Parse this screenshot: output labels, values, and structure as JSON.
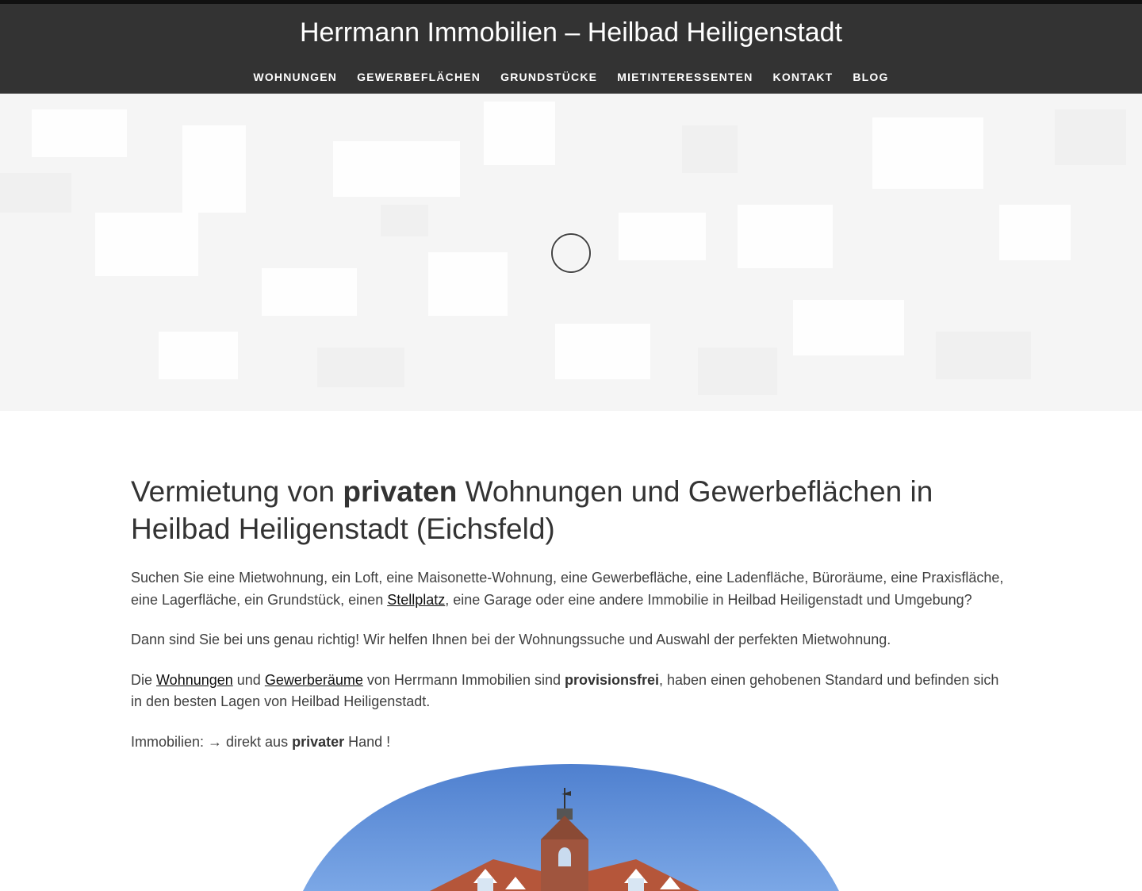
{
  "site": {
    "title": "Herrmann Immobilien – Heilbad Heiligenstadt"
  },
  "nav": {
    "items": [
      {
        "label": "WOHNUNGEN"
      },
      {
        "label": "GEWERBEFLÄCHEN"
      },
      {
        "label": "GRUNDSTÜCKE"
      },
      {
        "label": "MIETINTERESSENTEN"
      },
      {
        "label": "KONTAKT"
      },
      {
        "label": "BLOG"
      }
    ]
  },
  "hero": {
    "loader_icon": "loading-spinner-icon"
  },
  "main": {
    "headline": {
      "part1": "Vermietung von ",
      "bold": "privaten",
      "part2": " Wohnungen und Gewerbeflächen in Heilbad Heiligenstadt (Eichsfeld)"
    },
    "p1": {
      "text1": "Suchen Sie eine Mietwohnung, ein Loft, eine Maisonette-Wohnung, eine Gewerbefläche, eine Ladenfläche, Büroräume, eine Praxisfläche, eine Lagerfläche, ein Grundstück, einen ",
      "link": "Stellplatz",
      "text2": ", eine Garage oder eine andere Immobilie in Heilbad Heiligenstadt und Umgebung?"
    },
    "p2": {
      "text": "Dann sind Sie bei uns genau richtig! Wir helfen Ihnen bei der Wohnungssuche und Auswahl der perfekten Mietwohnung."
    },
    "p3": {
      "text1": "Die ",
      "link1": "Wohnungen",
      "text2": " und ",
      "link2": "Gewerberäume",
      "text3": " von Herrmann Immobilien sind ",
      "bold": "provisionsfrei",
      "text4": ", haben einen gehobenen Standard und befinden sich in den besten Lagen von Heilbad Heiligenstadt."
    },
    "p4": {
      "text1": "Immobilien: → direkt aus ",
      "bold": "privater",
      "text2": " Hand !"
    }
  },
  "colors": {
    "header_bg": "#333333",
    "sky": "#5b8fd9",
    "roof": "#b5563a"
  }
}
